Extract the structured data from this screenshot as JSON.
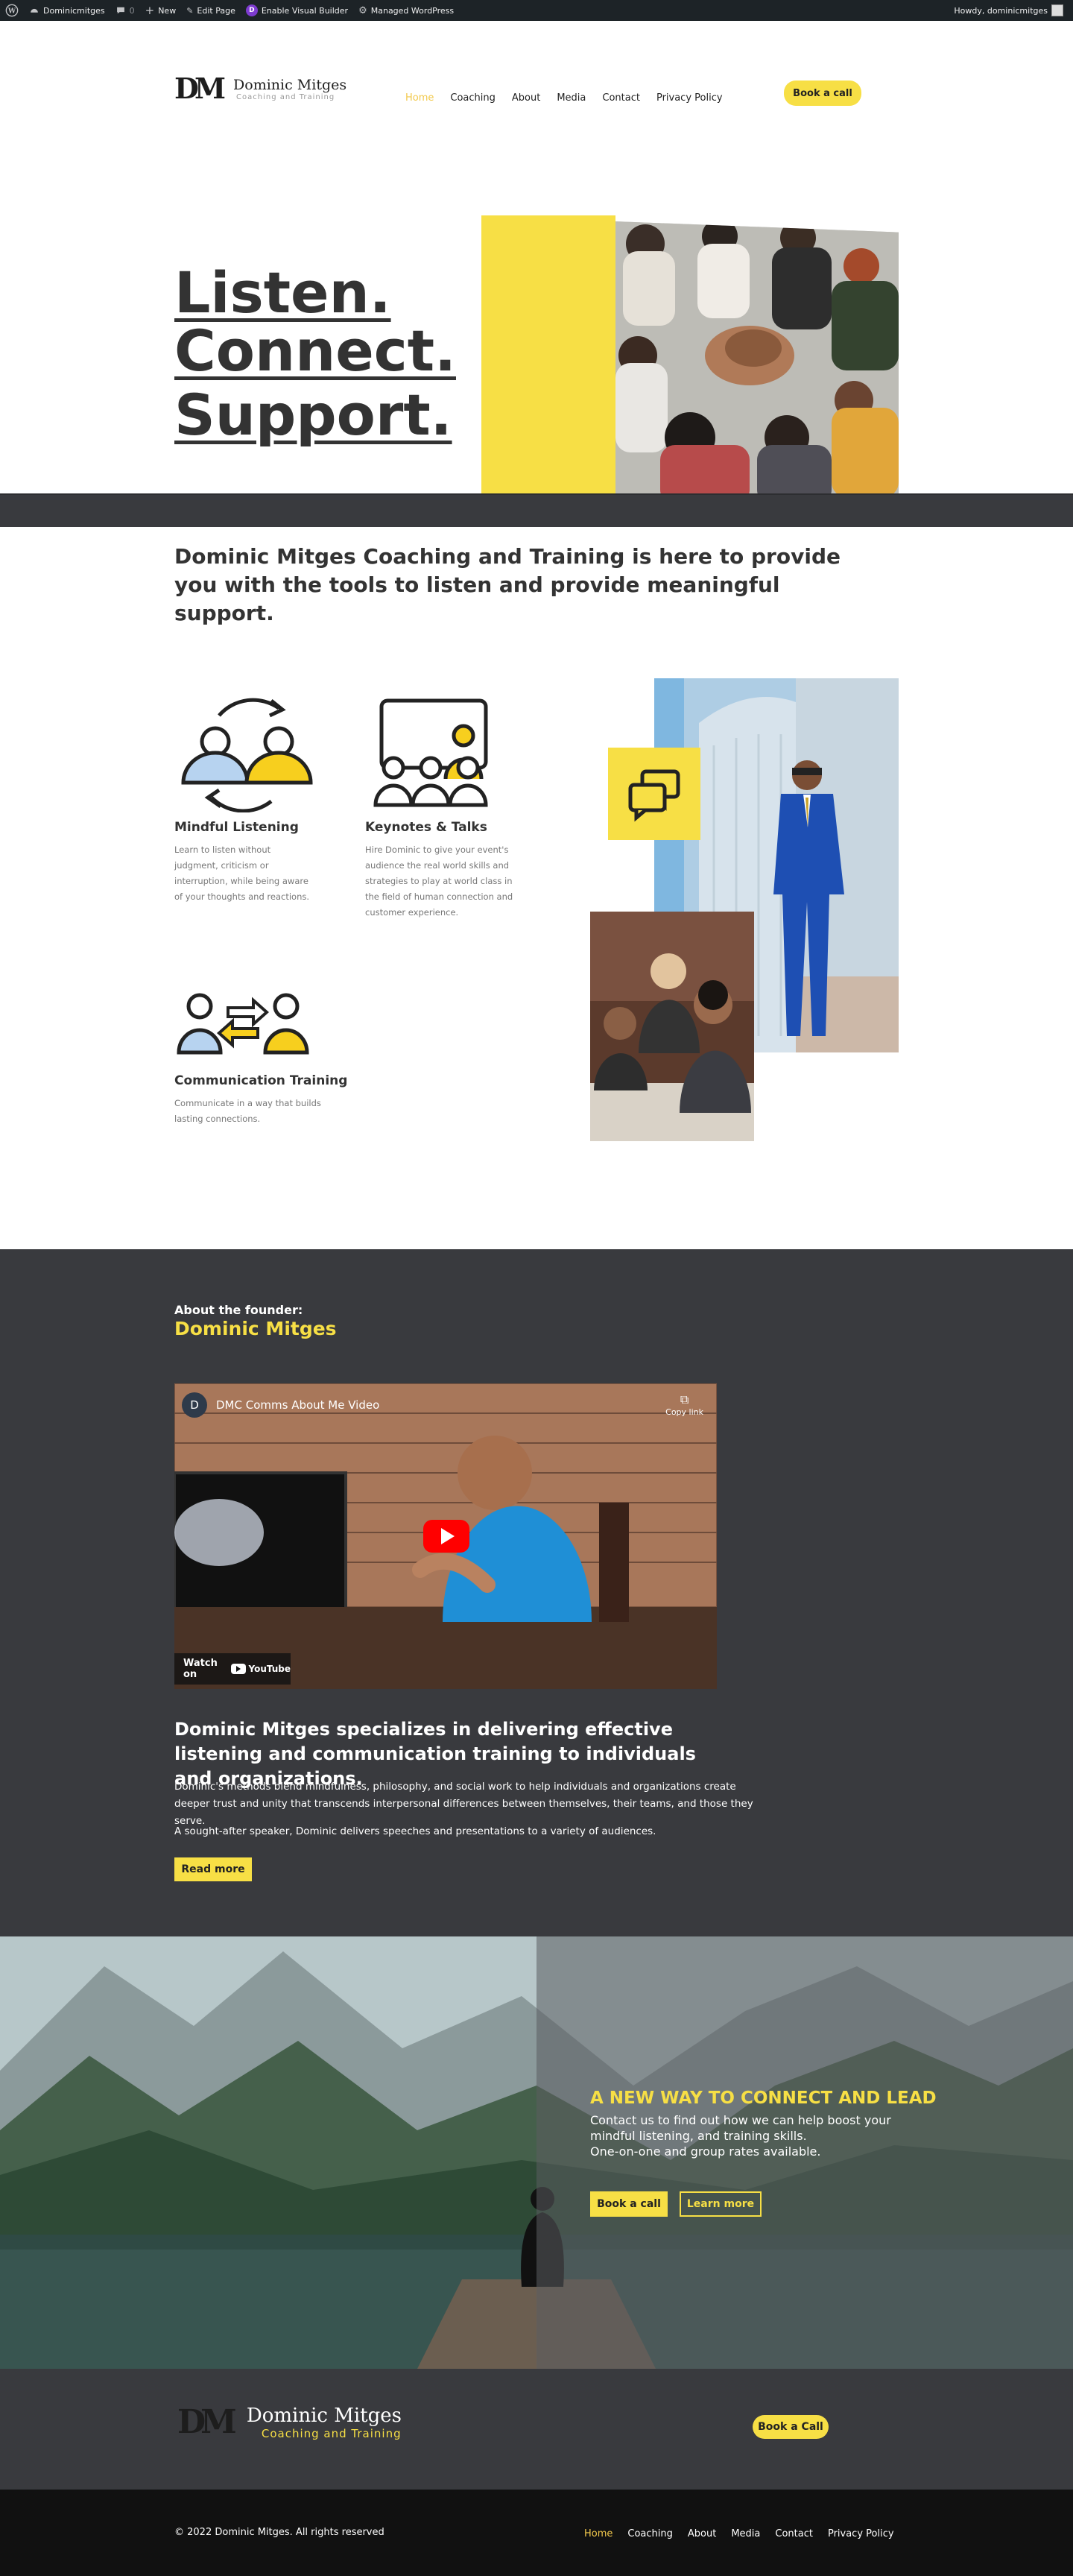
{
  "adminbar": {
    "site_name": "Dominicmitges",
    "comments_count": "0",
    "new_label": "New",
    "edit_label": "Edit Page",
    "builder_label": "Enable Visual Builder",
    "managed_label": "Managed WordPress",
    "howdy": "Howdy, dominicmitges"
  },
  "header": {
    "logo_mark": "DM",
    "logo_title": "Dominic Mitges",
    "logo_subtitle": "Coaching and Training",
    "nav": [
      "Home",
      "Coaching",
      "About",
      "Media",
      "Contact",
      "Privacy Policy"
    ],
    "cta": "Book a call"
  },
  "hero": {
    "line1": "Listen.",
    "line2": "Connect.",
    "line3": "Support."
  },
  "intro": "Dominic Mitges Coaching and Training is here to provide you with the tools to listen and provide meaningful support.",
  "services": [
    {
      "icon": "listening-people-icon",
      "title": "Mindful Listening",
      "text": "Learn to listen without judgment, criticism or interruption, while being aware of your thoughts and reactions."
    },
    {
      "icon": "presentation-board-icon",
      "title": "Keynotes & Talks",
      "text": "Hire Dominic to give your event's audience the real world skills and strategies to play at world class in the field of human connection and customer experience."
    },
    {
      "icon": "exchange-people-icon",
      "title": "Communication Training",
      "text": "Communicate in a way that builds lasting connections."
    }
  ],
  "founder": {
    "kicker": "About the founder:",
    "name": "Dominic Mitges",
    "video_title": "DMC Comms About Me Video",
    "video_channel_initial": "D",
    "copy_link": "Copy link",
    "watch_on": "Watch on",
    "youtube": "YouTube",
    "headline": "Dominic Mitges specializes in delivering effective listening and communication training to individuals and organizations.",
    "para1": "Dominic's methods blend mindfulness, philosophy, and social work to help individuals and organizations create deeper trust and unity that transcends interpersonal differences between themselves, their teams, and those they serve.",
    "para2": "A sought-after speaker, Dominic delivers speeches and presentations to a variety of audiences.",
    "read_more": "Read more"
  },
  "cta_section": {
    "title": "A NEW WAY TO CONNECT AND LEAD",
    "text1": "Contact us to find out how we can help boost your",
    "text2": "mindful listening, and training skills.",
    "text3": "One-on-one and group rates available.",
    "book": "Book a call",
    "learn": "Learn more"
  },
  "footer": {
    "logo_mark": "DM",
    "logo_title": "Dominic Mitges",
    "logo_subtitle": "Coaching and Training",
    "cta": "Book a Call",
    "copyright": "© 2022 Dominic Mitges. All rights reserved",
    "nav": [
      "Home",
      "Coaching",
      "About",
      "Media",
      "Contact",
      "Privacy Policy"
    ]
  },
  "colors": {
    "accent": "#f7df45",
    "dark": "#393a3e",
    "text": "#333333"
  }
}
